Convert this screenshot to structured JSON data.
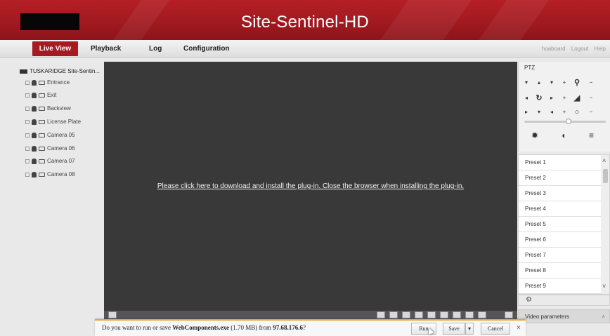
{
  "header": {
    "title": "Site-Sentinel-HD"
  },
  "nav": {
    "tabs": [
      {
        "label": "Live View",
        "active": true
      },
      {
        "label": "Playback"
      },
      {
        "label": "Log"
      },
      {
        "label": "Configuration"
      }
    ],
    "user": {
      "name": "hoaboard",
      "logout": "Logout",
      "help": "Help"
    }
  },
  "tree": {
    "root": "TUSKARIDGE Site-Sentin...",
    "cameras": [
      "Entrance",
      "Exit",
      "Backview",
      "License Plate",
      "Camera 05",
      "Camera 06",
      "Camera 07",
      "Camera 08"
    ]
  },
  "video": {
    "plugin_message": "Please click here to download and install the plug-in. Close the browser when installing the plug-in."
  },
  "ptz": {
    "title": "PTZ",
    "speed_level": 0.55
  },
  "presets": {
    "items": [
      "Preset 1",
      "Preset 2",
      "Preset 3",
      "Preset 4",
      "Preset 5",
      "Preset 6",
      "Preset 7",
      "Preset 8",
      "Preset 9"
    ]
  },
  "video_params": {
    "label": "Video parameters"
  },
  "download": {
    "prefix": "Do you want to run or save ",
    "file": "WebComponents.exe",
    "size": " (1.70 MB) from ",
    "host": "97.68.176.6",
    "suffix": "?",
    "run": "Run",
    "save": "Save",
    "cancel": "Cancel"
  },
  "colors": {
    "brand": "#a51b21",
    "video_bg": "#393939",
    "notification_accent": "#e9a43a"
  }
}
